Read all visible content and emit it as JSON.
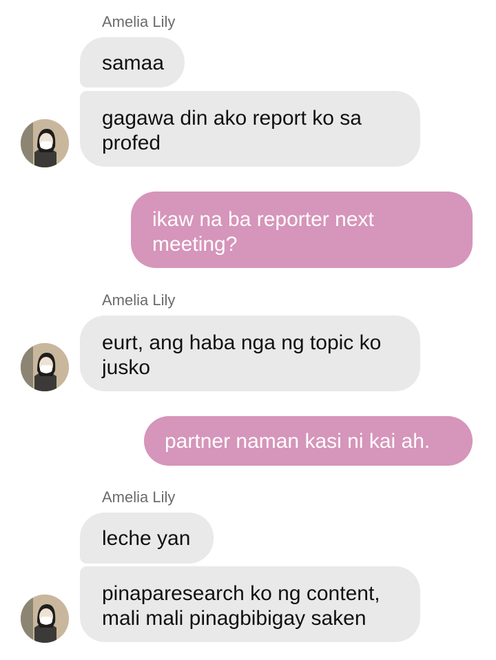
{
  "chat": {
    "messages": [
      {
        "sender": "Amelia Lily",
        "text": "samaa"
      },
      {
        "sender": "Amelia Lily",
        "text": "gagawa din ako report ko sa\nprofed"
      },
      {
        "sender": "me",
        "text": "ikaw na ba reporter next\nmeeting?"
      },
      {
        "sender": "Amelia Lily",
        "text": "eurt, ang haba nga ng topic ko\njusko"
      },
      {
        "sender": "me",
        "text": "partner naman kasi ni kai ah."
      },
      {
        "sender": "Amelia Lily",
        "text": "leche yan"
      },
      {
        "sender": "Amelia Lily",
        "text": "pinaparesearch ko ng content,\nmali mali pinagbibigay saken"
      }
    ],
    "sender_labels": [
      "Amelia Lily",
      "Amelia Lily",
      "Amelia Lily"
    ]
  },
  "colors": {
    "incoming_bubble": "#e9e9e9",
    "outgoing_bubble": "#d695ba",
    "sender_label": "#6b6b6b"
  },
  "icons": {
    "avatar": "profile-photo-avatar"
  }
}
